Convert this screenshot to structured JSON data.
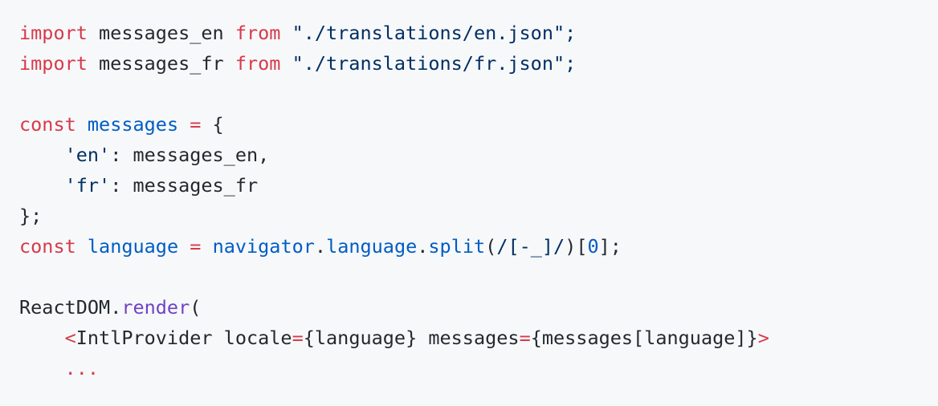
{
  "colors": {
    "background": "#f6f8fa",
    "plain": "#24292e",
    "keyword": "#d73a49",
    "string": "#032f62",
    "entity": "#005cc5",
    "function": "#6f42c1"
  },
  "code": {
    "lines": [
      [
        {
          "t": "import",
          "c": "keyword"
        },
        {
          "t": " messages_en ",
          "c": "plain"
        },
        {
          "t": "from",
          "c": "keyword"
        },
        {
          "t": " \"./translations/en.json\";",
          "c": "string"
        }
      ],
      [
        {
          "t": "import",
          "c": "keyword"
        },
        {
          "t": " messages_fr ",
          "c": "plain"
        },
        {
          "t": "from",
          "c": "keyword"
        },
        {
          "t": " \"./translations/fr.json\";",
          "c": "string"
        }
      ],
      [],
      [
        {
          "t": "const",
          "c": "keyword"
        },
        {
          "t": " ",
          "c": "plain"
        },
        {
          "t": "messages",
          "c": "entity"
        },
        {
          "t": " ",
          "c": "plain"
        },
        {
          "t": "=",
          "c": "keyword"
        },
        {
          "t": " {",
          "c": "plain"
        }
      ],
      [
        {
          "t": "    ",
          "c": "plain"
        },
        {
          "t": "'en'",
          "c": "string"
        },
        {
          "t": ": messages_en,",
          "c": "plain"
        }
      ],
      [
        {
          "t": "    ",
          "c": "plain"
        },
        {
          "t": "'fr'",
          "c": "string"
        },
        {
          "t": ": messages_fr",
          "c": "plain"
        }
      ],
      [
        {
          "t": "};",
          "c": "plain"
        }
      ],
      [
        {
          "t": "const",
          "c": "keyword"
        },
        {
          "t": " ",
          "c": "plain"
        },
        {
          "t": "language",
          "c": "entity"
        },
        {
          "t": " ",
          "c": "plain"
        },
        {
          "t": "=",
          "c": "keyword"
        },
        {
          "t": " ",
          "c": "plain"
        },
        {
          "t": "navigator",
          "c": "entity"
        },
        {
          "t": ".",
          "c": "plain"
        },
        {
          "t": "language",
          "c": "entity"
        },
        {
          "t": ".",
          "c": "plain"
        },
        {
          "t": "split",
          "c": "entity"
        },
        {
          "t": "(",
          "c": "plain"
        },
        {
          "t": "/[-_]/",
          "c": "string"
        },
        {
          "t": ")[",
          "c": "plain"
        },
        {
          "t": "0",
          "c": "entity"
        },
        {
          "t": "];",
          "c": "plain"
        }
      ],
      [],
      [
        {
          "t": "ReactDOM",
          "c": "plain"
        },
        {
          "t": ".",
          "c": "plain"
        },
        {
          "t": "render",
          "c": "function"
        },
        {
          "t": "(",
          "c": "plain"
        }
      ],
      [
        {
          "t": "    ",
          "c": "plain"
        },
        {
          "t": "<",
          "c": "keyword"
        },
        {
          "t": "IntlProvider locale",
          "c": "plain"
        },
        {
          "t": "=",
          "c": "keyword"
        },
        {
          "t": "{language} messages",
          "c": "plain"
        },
        {
          "t": "=",
          "c": "keyword"
        },
        {
          "t": "{messages[language]}",
          "c": "plain"
        },
        {
          "t": ">",
          "c": "keyword"
        }
      ],
      [
        {
          "t": "    ",
          "c": "plain"
        },
        {
          "t": "...",
          "c": "keyword"
        }
      ]
    ]
  }
}
